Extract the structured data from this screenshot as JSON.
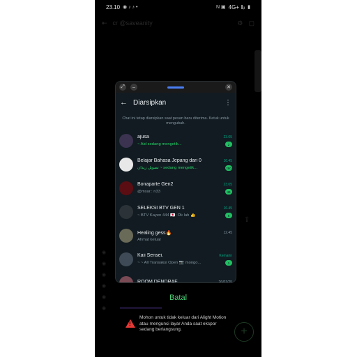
{
  "status_bar": {
    "time": "23.10",
    "right_text": "4G+ ‖ᵢₗ"
  },
  "background_app": {
    "title": "cr @saveanity"
  },
  "archived_window": {
    "title": "Diarsipkan",
    "info": "Chat ini tetap diarsipkan saat pesan baru diterima. Ketuk untuk mengubah.",
    "chats": [
      {
        "name": "ajusa",
        "time": "23.05",
        "message": "~ Aid sedang mengetik...",
        "badge": "2",
        "message_green": true,
        "time_green": true,
        "avatar_color": "#3b3350"
      },
      {
        "name": "Belajar Bahasa Jepang dari 0",
        "time": "16.45",
        "message": "ﺗﺼﻮﯾﻞ ﺯﯾﺪﺍﻥ ~ sedang mengetik...",
        "badge": "280",
        "message_green": true,
        "time_green": true,
        "avatar_color": "#e8e8e8"
      },
      {
        "name": "Bonaparte Gen2",
        "time": "23.05",
        "message": "@msar.: n33",
        "badge": "49",
        "message_green": false,
        "time_green": true,
        "avatar_color": "#5a0d12"
      },
      {
        "name": "SELEKSI BTV GEN 1",
        "time": "16.45",
        "message": "~ BTV Kayen 444 🇯🇵: Ok lah 👍",
        "badge": "6",
        "message_green": false,
        "time_green": true,
        "avatar_color": "#2c3338"
      },
      {
        "name": "Healing gess🔥",
        "time": "12.45",
        "message": "Ahmat keluar",
        "badge": "",
        "message_green": false,
        "time_green": false,
        "avatar_color": "#6a6a58"
      },
      {
        "name": "Kaii Sensei.",
        "time": "Kemarin",
        "message": "~ ~ All Transaksi Open 📷 mongo...",
        "badge": "1",
        "message_green": false,
        "time_green": true,
        "avatar_color": "#3e4a55"
      },
      {
        "name": "ROOM DENDRAF",
        "time": "26/01/25",
        "message": "",
        "badge": "",
        "message_green": false,
        "time_green": false,
        "avatar_color": "#7a4a55"
      }
    ]
  },
  "cancel_label": "Batal",
  "notice": "Mohon untuk tidak keluar dari Alight Motion atau mengunci layar Anda saat ekspor sedang berlangsung.",
  "colors": {
    "accent_green": "#25d366",
    "window_bg": "#111b21",
    "warning_red": "#e53935"
  }
}
